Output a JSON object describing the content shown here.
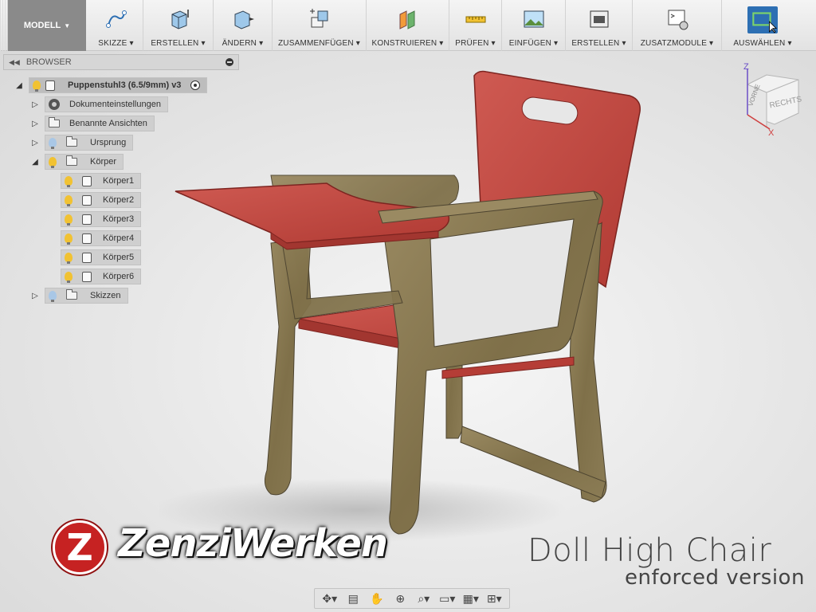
{
  "toolbar": {
    "workspace": "MODELL",
    "groups": [
      {
        "label": "SKIZZE",
        "icon": "sketch-icon"
      },
      {
        "label": "ERSTELLEN",
        "icon": "create-box-icon"
      },
      {
        "label": "ÄNDERN",
        "icon": "modify-icon"
      },
      {
        "label": "ZUSAMMENFÜGEN",
        "icon": "assemble-icon"
      },
      {
        "label": "KONSTRUIEREN",
        "icon": "construct-plane-icon"
      },
      {
        "label": "PRÜFEN",
        "icon": "measure-ruler-icon"
      },
      {
        "label": "EINFÜGEN",
        "icon": "insert-image-icon"
      },
      {
        "label": "ERSTELLEN",
        "icon": "make-printer-icon"
      },
      {
        "label": "ZUSATZMODULE",
        "icon": "scripts-addins-icon"
      },
      {
        "label": "AUSWÄHLEN",
        "icon": "select-icon"
      }
    ],
    "colors": {
      "select_accent": "#2d6fb3"
    }
  },
  "browser": {
    "title": "BROWSER",
    "root": "Puppenstuhl3 (6.5/9mm) v3",
    "items": {
      "document_settings": "Dokumenteinstellungen",
      "named_views": "Benannte Ansichten",
      "origin": "Ursprung",
      "bodies": "Körper",
      "sketches": "Skizzen"
    },
    "bodies": [
      "Körper1",
      "Körper2",
      "Körper3",
      "Körper4",
      "Körper5",
      "Körper6"
    ]
  },
  "viewcube": {
    "face": "RECHTS",
    "side": "VORNE",
    "axis_z": "Z",
    "axis_x": "X"
  },
  "overlay": {
    "logo_letter": "Z",
    "logo_text": "ZenziWerken",
    "title": "Doll High Chair",
    "subtitle": "enforced version"
  },
  "colors": {
    "wood": "#8a7a55",
    "red": "#c5423b",
    "logo_red": "#c62222"
  }
}
